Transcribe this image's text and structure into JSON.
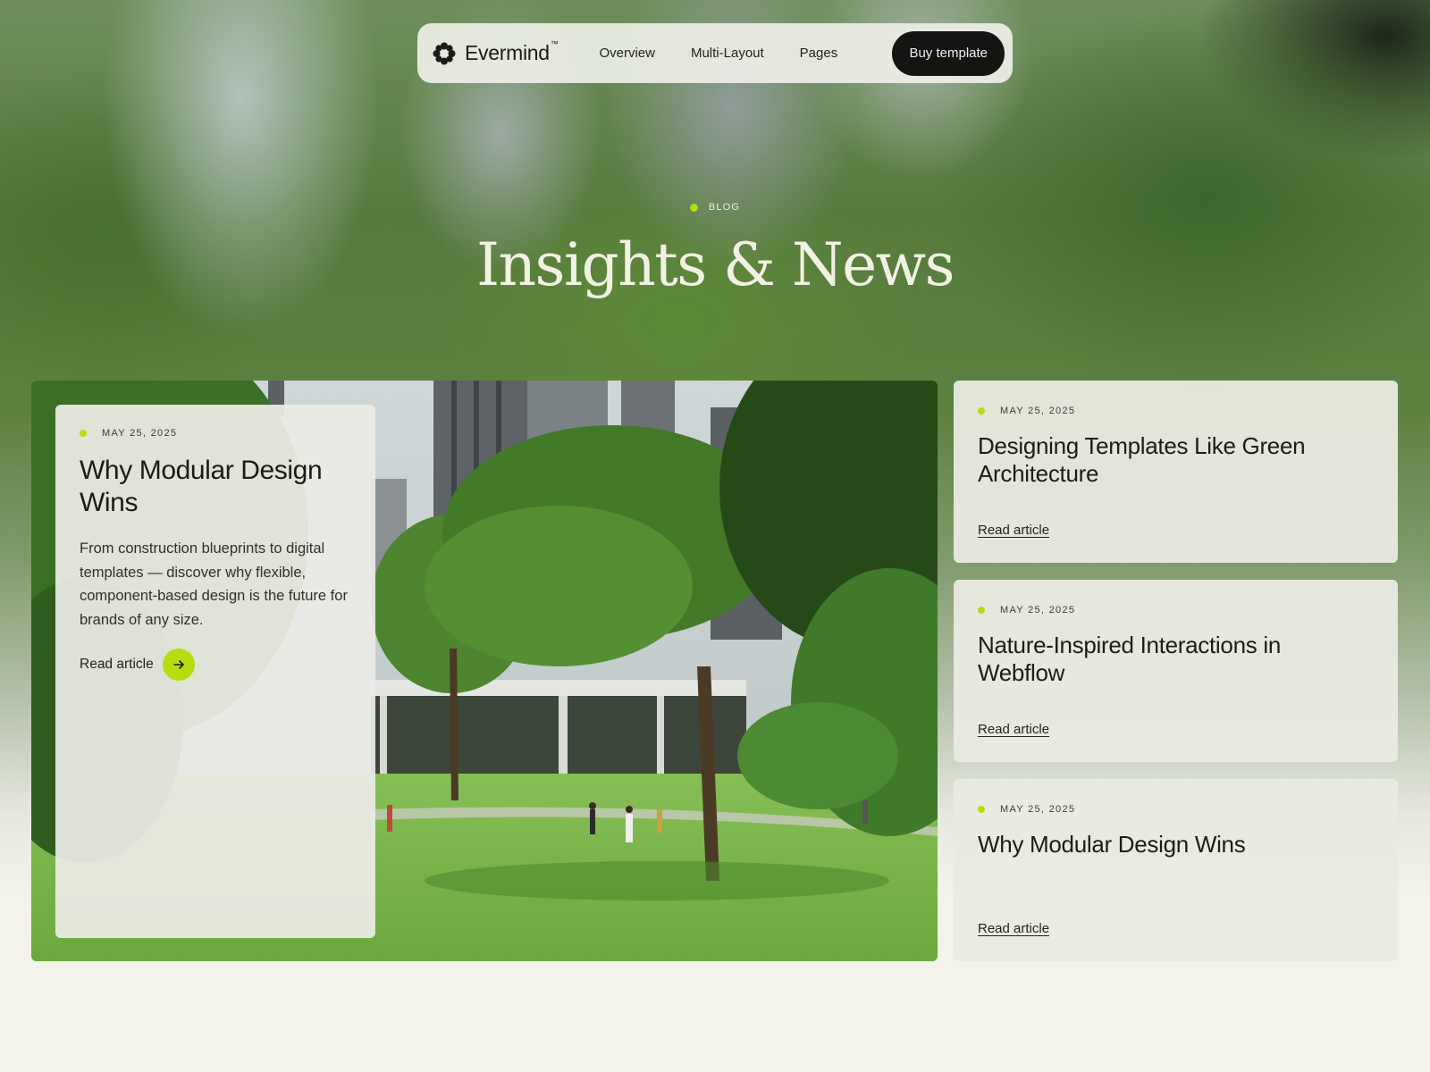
{
  "nav": {
    "brand": "Evermind",
    "trademark": "™",
    "links": [
      "Overview",
      "Multi-Layout",
      "Pages"
    ],
    "cta": "Buy template"
  },
  "hero": {
    "eyebrow": "BLOG",
    "title": "Insights & News"
  },
  "featured": {
    "date": "MAY 25, 2025",
    "title": "Why Modular Design Wins",
    "description": "From construction blueprints to digital templates — discover why flexible, component-based design is the future for brands of any size.",
    "link": "Read article"
  },
  "articles": [
    {
      "date": "MAY 25, 2025",
      "title": "Designing Templates Like Green Architecture",
      "link": "Read article"
    },
    {
      "date": "MAY 25, 2025",
      "title": "Nature-Inspired Interactions in Webflow",
      "link": "Read article"
    },
    {
      "date": "MAY 25, 2025",
      "title": "Why Modular Design Wins",
      "link": "Read article"
    }
  ],
  "colors": {
    "accent": "#b7dd10",
    "dark": "#141512",
    "background": "#f3f3ec"
  }
}
